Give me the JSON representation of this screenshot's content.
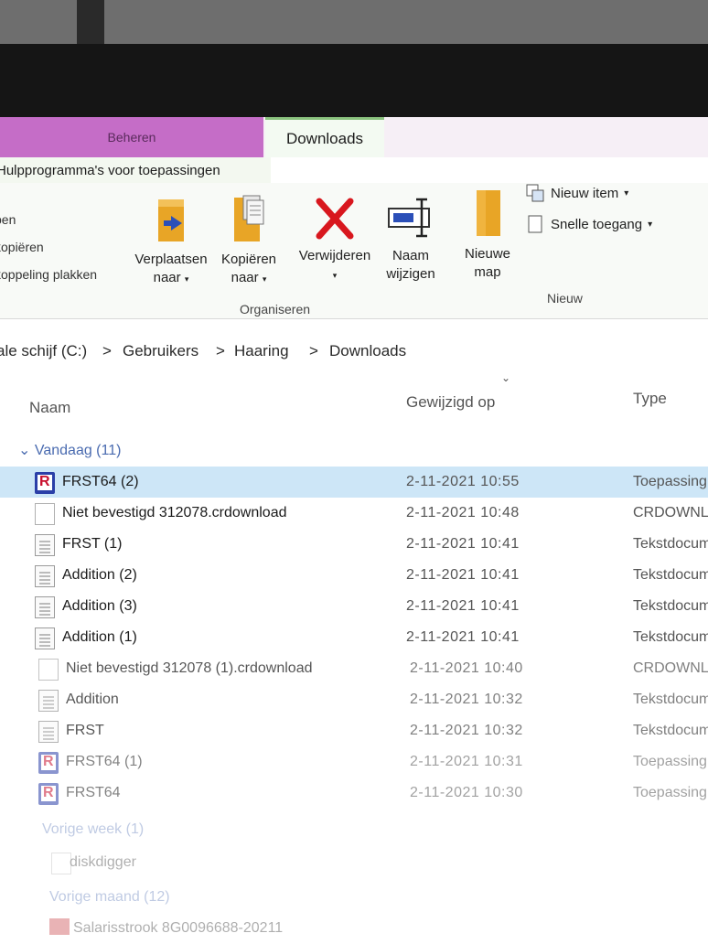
{
  "ribbon": {
    "tabs": {
      "context_tab": "Beheren",
      "active_tab": "Downloads",
      "context_label": "Hulpprogramma's voor toepassingen"
    },
    "clipboard_items": [
      "pen",
      "kopiëren",
      "koppeling plakken"
    ],
    "organiseren": {
      "move_line1": "Verplaatsen",
      "move_line2": "naar",
      "copy_line1": "Kopiëren",
      "copy_line2": "naar",
      "delete_label": "Verwijderen",
      "rename_line1": "Naam",
      "rename_line2": "wijzigen",
      "group_label": "Organiseren"
    },
    "nieuw": {
      "newfolder_line1": "Nieuwe",
      "newfolder_line2": "map",
      "new_item": "Nieuw item",
      "quick_access": "Snelle toegang",
      "group_label": "Nieuw"
    }
  },
  "address": {
    "segments": [
      "ale schijf (C:)",
      "Gebruikers",
      "Haaring",
      "Downloads"
    ],
    "separator": ">"
  },
  "columns": {
    "name": "Naam",
    "modified": "Gewijzigd op",
    "type": "Type"
  },
  "groups": {
    "today": "Vandaag (11)",
    "last_week": "Vorige week (1)",
    "last_month": "Vorige maand (12)"
  },
  "files": [
    {
      "name": "FRST64 (2)",
      "date": "2-11-2021 10:55",
      "type": "Toepassing",
      "icon": "frst-app-icon"
    },
    {
      "name": "Niet bevestigd 312078.crdownload",
      "date": "2-11-2021 10:48",
      "type": "CRDOWNLOAD",
      "icon": "blank-file-icon"
    },
    {
      "name": "FRST (1)",
      "date": "2-11-2021 10:41",
      "type": "Tekstdocument",
      "icon": "text-file-icon"
    },
    {
      "name": "Addition (2)",
      "date": "2-11-2021 10:41",
      "type": "Tekstdocument",
      "icon": "text-file-icon"
    },
    {
      "name": "Addition (3)",
      "date": "2-11-2021 10:41",
      "type": "Tekstdocument",
      "icon": "text-file-icon"
    },
    {
      "name": "Addition (1)",
      "date": "2-11-2021 10:41",
      "type": "Tekstdocument",
      "icon": "text-file-icon"
    },
    {
      "name": "Niet bevestigd 312078 (1).crdownload",
      "date": "2-11-2021 10:40",
      "type": "CRDOWNLOAD",
      "icon": "blank-file-icon"
    },
    {
      "name": "Addition",
      "date": "2-11-2021 10:32",
      "type": "Tekstdocument",
      "icon": "text-file-icon"
    },
    {
      "name": "FRST",
      "date": "2-11-2021 10:32",
      "type": "Tekstdocument",
      "icon": "text-file-icon"
    },
    {
      "name": "FRST64 (1)",
      "date": "2-11-2021 10:31",
      "type": "Toepassing",
      "icon": "frst-app-icon"
    },
    {
      "name": "FRST64",
      "date": "2-11-2021 10:30",
      "type": "Toepassing",
      "icon": "frst-app-icon"
    }
  ],
  "last_week_files": [
    {
      "name": "diskdigger",
      "icon": "blank-file-icon"
    }
  ],
  "last_month_files": [
    {
      "name": "Salarisstrook 8G0096688-20211",
      "icon": "pdf-file-icon"
    }
  ],
  "colors": {
    "context_tab": "#c56dc7",
    "selection": "#cde6f7",
    "group_header": "#4a6bb0"
  }
}
